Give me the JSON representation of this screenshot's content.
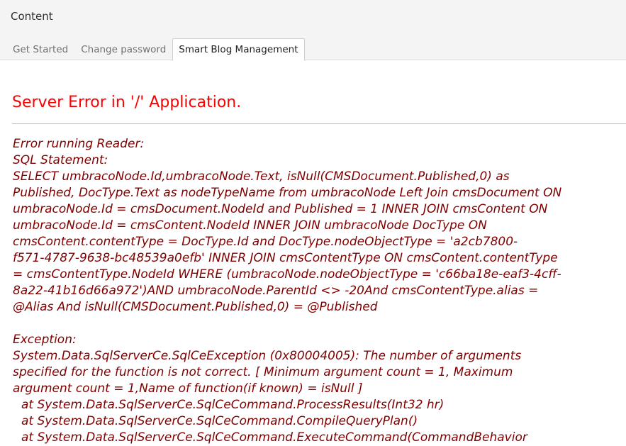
{
  "header": {
    "title": "Content",
    "tabs": [
      {
        "label": "Get Started",
        "active": false
      },
      {
        "label": "Change password",
        "active": false
      },
      {
        "label": "Smart Blog Management",
        "active": true
      }
    ]
  },
  "error": {
    "heading": "Server Error in '/' Application.",
    "sql_lines": [
      "Error running Reader:",
      "SQL Statement:",
      "SELECT  umbracoNode.Id,umbracoNode.Text, isNull(CMSDocument.Published,0) as",
      "Published, DocType.Text as nodeTypeName  from umbracoNode Left Join cmsDocument ON",
      "umbracoNode.Id = cmsDocument.NodeId and Published = 1 INNER JOIN cmsContent ON",
      "umbracoNode.Id = cmsContent.NodeId INNER JOIN umbracoNode DocType ON",
      "cmsContent.contentType = DocType.Id and DocType.nodeObjectType = 'a2cb7800-",
      "f571-4787-9638-bc48539a0efb'  INNER JOIN cmsContentType ON cmsContent.contentType",
      "= cmsContentType.NodeId WHERE (umbracoNode.nodeObjectType = 'c66ba18e-eaf3-4cff-",
      "8a22-41b16d66a972')AND umbracoNode.ParentId <> -20And cmsContentType.alias =",
      "@Alias And isNull(CMSDocument.Published,0) = @Published"
    ],
    "exception_lines": [
      "Exception:",
      "System.Data.SqlServerCe.SqlCeException (0x80004005): The number of arguments",
      "specified for the function is not correct. [ Minimum argument count = 1, Maximum",
      "argument count = 1,Name of function(if known) = isNull ]"
    ],
    "stack_lines": [
      "at System.Data.SqlServerCe.SqlCeCommand.ProcessResults(Int32 hr)",
      "at System.Data.SqlServerCe.SqlCeCommand.CompileQueryPlan()",
      "at System.Data.SqlServerCe.SqlCeCommand.ExecuteCommand(CommandBehavior"
    ]
  },
  "colors": {
    "heading": "#ff0000",
    "error_text": "#800000",
    "header_bg": "#f4f4f4"
  }
}
